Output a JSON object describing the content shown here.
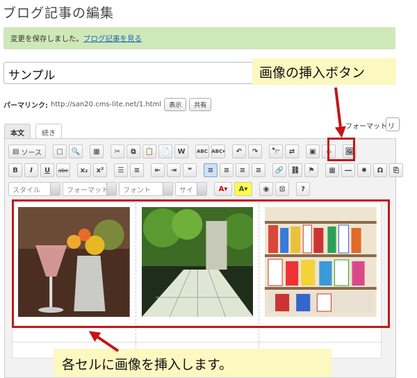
{
  "page": {
    "title": "ブログ記事の編集"
  },
  "notice": {
    "text": "変更を保存しました。",
    "link": "ブログ記事を見る"
  },
  "post": {
    "title_value": "サンプル"
  },
  "permalink": {
    "label": "パーマリンク:",
    "url": "http://san20.cms-lite.net/1.html",
    "view_button": "表示",
    "share_button": "共有"
  },
  "format": {
    "label": "フォーマット:",
    "value": "リ"
  },
  "tabs": [
    {
      "label": "本文"
    },
    {
      "label": "続き"
    }
  ],
  "toolbar": {
    "source_label": "ソース",
    "style_placeholder": "スタイル",
    "format_placeholder": "フォーマット",
    "font_placeholder": "フォント",
    "size_placeholder": "サイ",
    "bold": "B",
    "italic": "I",
    "underline": "U",
    "strike": "abc",
    "sub": "x₂",
    "sup": "x²",
    "help": "?"
  },
  "annotations": {
    "insert_image_button": "画像の挿入ボタン",
    "cells_hint": "各セルに画像を挿入します。"
  },
  "colors": {
    "notice_bg": "#cfe8b8",
    "callout_bg": "#fdf7c0",
    "highlight": "#c21616"
  }
}
